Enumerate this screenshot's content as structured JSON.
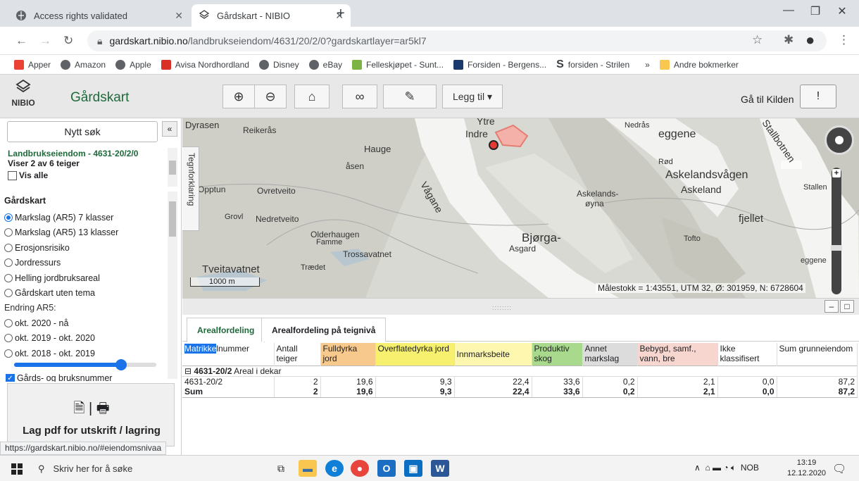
{
  "browser": {
    "tabs": [
      {
        "title": "Access rights validated",
        "active": false
      },
      {
        "title": "Gårdskart - NIBIO",
        "active": true
      }
    ],
    "url_host": "gardskart.nibio.no",
    "url_path": "/landbrukseiendom/4631/20/2/0?gardskartlayer=ar5kl7",
    "bookmarks": [
      {
        "label": "Apper",
        "color": "#ea4335"
      },
      {
        "label": "Amazon",
        "color": "#5f6368"
      },
      {
        "label": "Apple",
        "color": "#5f6368"
      },
      {
        "label": "Avisa Nordhordland",
        "color": "#d93025"
      },
      {
        "label": "Disney",
        "color": "#5f6368"
      },
      {
        "label": "eBay",
        "color": "#5f6368"
      },
      {
        "label": "Felleskjøpet - Sunt...",
        "color": "#7cb342"
      },
      {
        "label": "Forsiden - Bergens...",
        "color": "#1a3a6b"
      },
      {
        "label": "forsiden - Strilen",
        "color": "#000000"
      }
    ],
    "more": "»",
    "other_bookmarks": "Andre bokmerker"
  },
  "app": {
    "logo_text": "NIBIO",
    "title": "Gårdskart",
    "toolbar": {
      "zoom_in": "⊕",
      "zoom_out": "⊖",
      "home": "⌂",
      "link": "🔗",
      "draw": "✎",
      "add_label": "Legg til ▾"
    },
    "goto_kilden": "Gå til Kilden",
    "feedback_icon": "!"
  },
  "sidebar": {
    "new_search": "Nytt søk",
    "collapse": "«",
    "property_title": "Landbrukseiendom - 4631-20/2/0",
    "showing": "Viser 2 av 6 teiger",
    "show_all": "Vis alle",
    "layers_header": "Gårdskart",
    "layers": [
      {
        "label": "Markslag (AR5) 7 klasser",
        "checked": true
      },
      {
        "label": "Markslag (AR5) 13 klasser",
        "checked": false
      },
      {
        "label": "Erosjonsrisiko",
        "checked": false
      },
      {
        "label": "Jordressurs",
        "checked": false
      },
      {
        "label": "Helling jordbruksareal",
        "checked": false
      },
      {
        "label": "Gårdskart uten tema",
        "checked": false
      }
    ],
    "change_header": "Endring AR5:",
    "changes": [
      {
        "label": "okt. 2020 - nå",
        "checked": false
      },
      {
        "label": "okt. 2019 - okt. 2020",
        "checked": false
      },
      {
        "label": "okt. 2018 - okt. 2019",
        "checked": false
      }
    ],
    "opacity_percent": 75,
    "gards_label": "Gårds- og bruksnummer",
    "pdf_label": "Lag pdf for utskrift / lagring"
  },
  "status_url": "https://gardskart.nibio.no/#eiendomsnivaa",
  "map": {
    "legend_tab": "Tegnforklaring",
    "scale_text": "Målestokk = 1:43551, UTM 32,  Ø:  301959, N: 6728604",
    "scale_bar": "1000 m",
    "place_names": [
      "Dyrasen",
      "Reikerås",
      "Hauge",
      "åsen",
      "Indre",
      "Ytre",
      "Nedrås",
      "eggene",
      "Stallbotnen",
      "Rød",
      "Askelandsvågen",
      "Askeland",
      "Askelands-",
      "øyna",
      "Opptun",
      "Ovretveito",
      "Vågane",
      "Grovl",
      "Nedretveito",
      "Olderhaugen",
      "Famme",
      "Trossavatnet",
      "Bjørga-",
      "Asgard",
      "Tofto",
      "fjellet",
      "Tveitavatnet",
      "Trædet",
      "Stallen",
      "eggene"
    ]
  },
  "bottom_tabs": [
    "Arealfordeling",
    "Arealfordeling på teignivå"
  ],
  "table": {
    "headers": [
      {
        "label": "Matrikkelnummer",
        "bg": "#ffffff"
      },
      {
        "label": "Antall teiger",
        "bg": "#ffffff"
      },
      {
        "label": "Fulldyrka jord",
        "bg": "#f7c98c"
      },
      {
        "label": "Overflatedyrka jord",
        "bg": "#f7f06e"
      },
      {
        "label": "Innmarksbeite",
        "bg": "#fdf7b0"
      },
      {
        "label": "Produktiv skog",
        "bg": "#a8d98c"
      },
      {
        "label": "Annet markslag",
        "bg": "#dcdcdc"
      },
      {
        "label": "Bebygd, samf., vann, bre",
        "bg": "#f7d6d0"
      },
      {
        "label": "Ikke klassifisert",
        "bg": "#ffffff"
      },
      {
        "label": "Sum grunneiendom",
        "bg": "#ffffff"
      }
    ],
    "group_label": "4631-20/2",
    "group_suffix": " Areal i dekar",
    "rows": [
      [
        "4631-20/2",
        "2",
        "19,6",
        "9,3",
        "22,4",
        "33,6",
        "0,2",
        "2,1",
        "0,0",
        "87,2"
      ],
      [
        "Sum",
        "2",
        "19,6",
        "9,3",
        "22,4",
        "33,6",
        "0,2",
        "2,1",
        "0,0",
        "87,2"
      ]
    ]
  },
  "taskbar": {
    "search_placeholder": "Skriv her for å søke",
    "tray_lang": "NOB",
    "time": "13:19",
    "date": "12.12.2020"
  }
}
